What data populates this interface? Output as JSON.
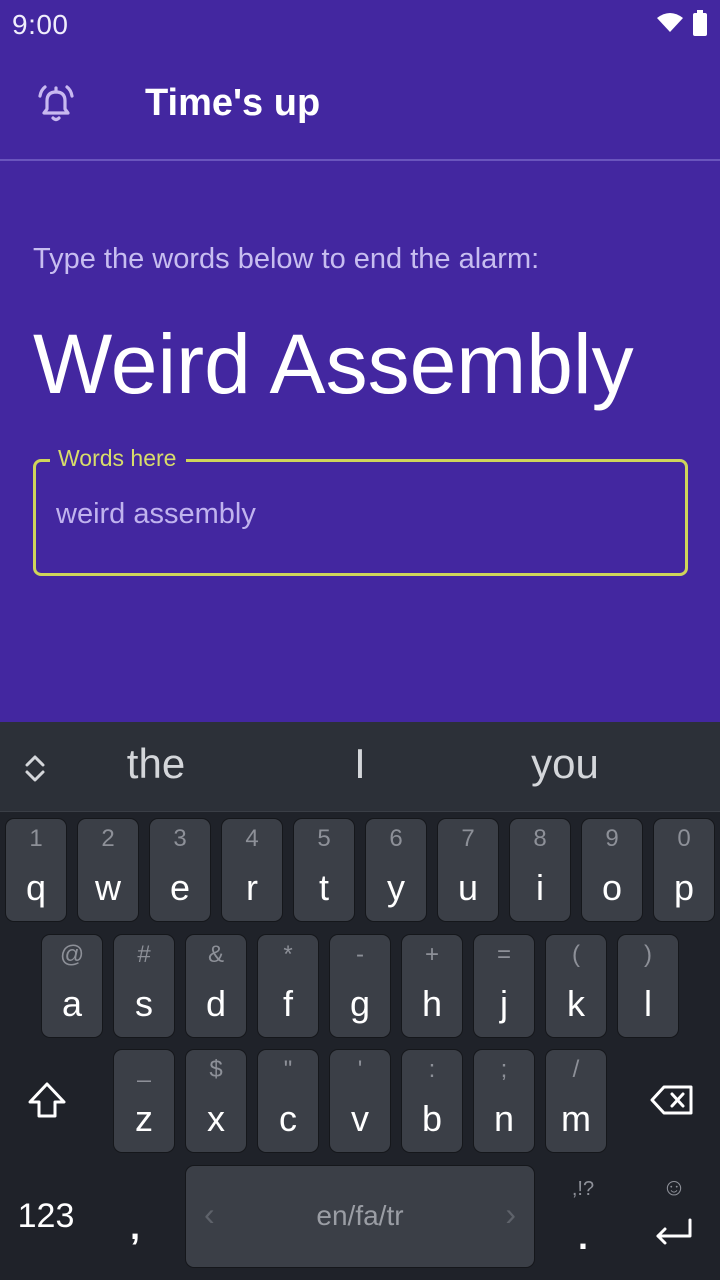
{
  "status": {
    "time": "9:00"
  },
  "appbar": {
    "title": "Time's up",
    "icon": "alarm-icon"
  },
  "instruction": "Type the words below to end the alarm:",
  "target_words": "Weird Assembly",
  "input": {
    "label": "Words here",
    "value": "weird assembly"
  },
  "keyboard": {
    "suggestions": [
      "the",
      "I",
      "you"
    ],
    "row1": [
      {
        "hint": "1",
        "key": "q"
      },
      {
        "hint": "2",
        "key": "w"
      },
      {
        "hint": "3",
        "key": "e"
      },
      {
        "hint": "4",
        "key": "r"
      },
      {
        "hint": "5",
        "key": "t"
      },
      {
        "hint": "6",
        "key": "y"
      },
      {
        "hint": "7",
        "key": "u"
      },
      {
        "hint": "8",
        "key": "i"
      },
      {
        "hint": "9",
        "key": "o"
      },
      {
        "hint": "0",
        "key": "p"
      }
    ],
    "row2": [
      {
        "hint": "@",
        "key": "a"
      },
      {
        "hint": "#",
        "key": "s"
      },
      {
        "hint": "&",
        "key": "d"
      },
      {
        "hint": "*",
        "key": "f"
      },
      {
        "hint": "-",
        "key": "g"
      },
      {
        "hint": "+",
        "key": "h"
      },
      {
        "hint": "=",
        "key": "j"
      },
      {
        "hint": "(",
        "key": "k"
      },
      {
        "hint": ")",
        "key": "l"
      }
    ],
    "row3": [
      {
        "hint": "_",
        "key": "z"
      },
      {
        "hint": "$",
        "key": "x"
      },
      {
        "hint": "\"",
        "key": "c"
      },
      {
        "hint": "'",
        "key": "v"
      },
      {
        "hint": ":",
        "key": "b"
      },
      {
        "hint": ";",
        "key": "n"
      },
      {
        "hint": "/",
        "key": "m"
      }
    ],
    "numbers_key": "123",
    "comma_key": ",",
    "space_label": "en/fa/tr",
    "punct_hint": ",!?",
    "period_key": ".",
    "emoji_hint": "☺"
  },
  "colors": {
    "background": "#4327a0",
    "accent": "#cfd55a",
    "keyboard_bg": "#1f2229",
    "key_bg": "#3b3f47"
  }
}
